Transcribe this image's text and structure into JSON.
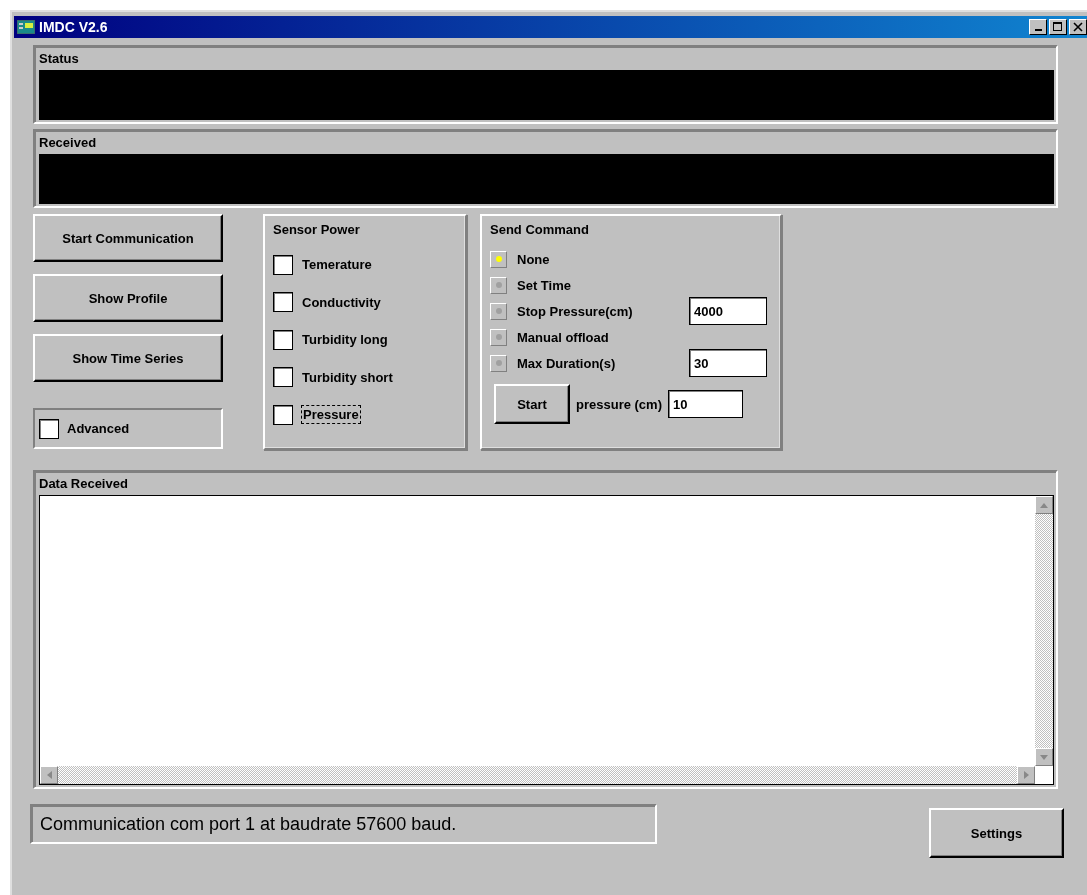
{
  "window": {
    "title": "IMDC V2.6"
  },
  "status_panel": {
    "label": "Status"
  },
  "received_panel": {
    "label": "Received"
  },
  "buttons": [
    "Start Communication",
    "Show Profile",
    "Show Time Series"
  ],
  "advanced": {
    "label": "Advanced",
    "checked": false
  },
  "sensor_power": {
    "title": "Sensor Power",
    "items": [
      {
        "label": "Temerature",
        "checked": false,
        "focused": false
      },
      {
        "label": "Conductivity",
        "checked": false,
        "focused": false
      },
      {
        "label": "Turbidity long",
        "checked": false,
        "focused": false
      },
      {
        "label": "Turbidity short",
        "checked": false,
        "focused": false
      },
      {
        "label": "Pressure",
        "checked": false,
        "focused": true
      }
    ]
  },
  "send_command": {
    "title": "Send Command",
    "options": [
      {
        "label": "None",
        "selected": true
      },
      {
        "label": "Set Time",
        "selected": false
      },
      {
        "label": "Stop Pressure(cm)",
        "selected": false,
        "value": "4000"
      },
      {
        "label": "Manual offload",
        "selected": false
      },
      {
        "label": "Max Duration(s)",
        "selected": false,
        "value": "30"
      }
    ],
    "start_button": "Start",
    "pressure_label": "pressure (cm)",
    "pressure_value": "10"
  },
  "data_received": {
    "label": "Data Received"
  },
  "status_line": "Communication com port 1 at baudrate 57600 baud.",
  "settings_button": "Settings"
}
